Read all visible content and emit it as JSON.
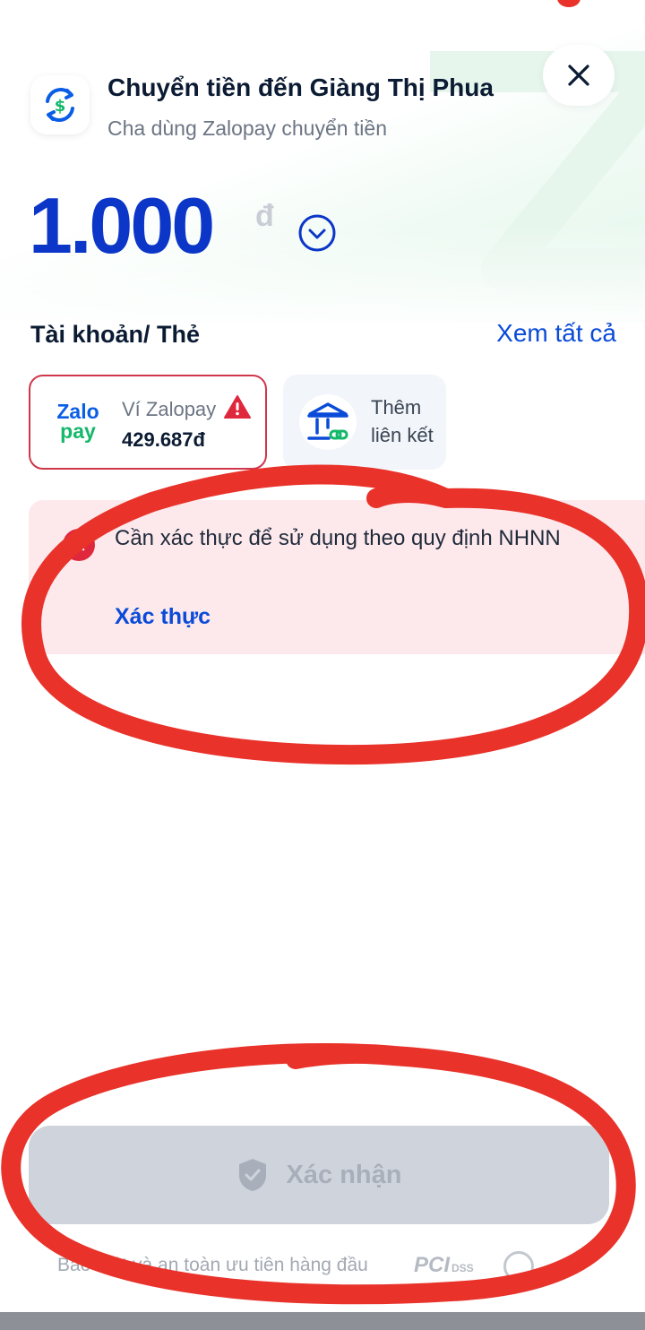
{
  "header": {
    "title": "Chuyển tiền đến Giàng Thị Phua",
    "subtitle": "Cha dùng Zalopay chuyển tiền",
    "icon": "dollar-exchange-icon",
    "close_icon": "close-icon"
  },
  "amount": {
    "value": "1.000",
    "unit": "đ",
    "dropdown_icon": "chevron-down-circle-icon"
  },
  "accounts": {
    "title": "Tài khoản/ Thẻ",
    "see_all": "Xem tất cả",
    "wallet": {
      "logo_top": "Zalo",
      "logo_bottom": "pay",
      "name": "Ví Zalopay",
      "balance": "429.687đ",
      "warning_icon": "warning-triangle-icon"
    },
    "add_link": {
      "line1": "Thêm",
      "line2": "liên kết",
      "icon": "bank-link-icon"
    }
  },
  "alert": {
    "message": "Cần xác thực để sử dụng theo quy định NHNN",
    "action": "Xác thực",
    "icon": "error-circle-icon"
  },
  "confirm": {
    "label": "Xác nhận",
    "icon": "shield-icon"
  },
  "footer": {
    "text": "Bảo mật và an toàn ưu tiên hàng đầu",
    "pci": "PCI",
    "dss": "DSS"
  },
  "colors": {
    "primary": "#0a4bd8",
    "amount": "#0b36c8",
    "danger": "#e0283d",
    "alert_bg": "#fde9ec",
    "disabled_btn": "#cfd4dc",
    "annotation": "#e8322a"
  }
}
